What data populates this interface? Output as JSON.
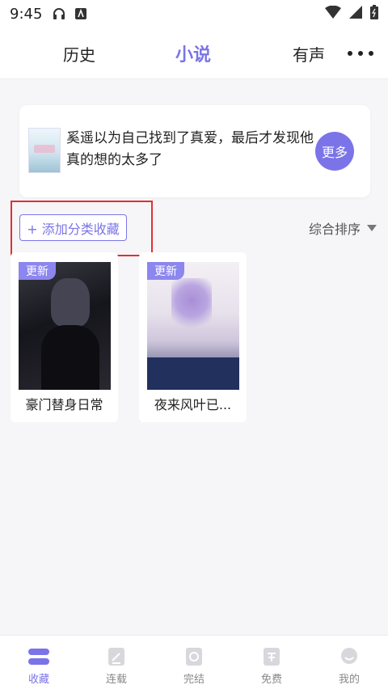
{
  "status_bar": {
    "time": "9:45"
  },
  "top_tabs": [
    {
      "label": "历史"
    },
    {
      "label": "小说"
    },
    {
      "label": "有声"
    }
  ],
  "recommendation": {
    "text": "奚遥以为自己找到了真爱，最后才发现他真的想的太多了",
    "more_label": "更多"
  },
  "toolbar": {
    "add_category_label": "+ 添加分类收藏",
    "sort_label": "综合排序"
  },
  "books": [
    {
      "badge": "更新",
      "title": "豪门替身日常"
    },
    {
      "badge": "更新",
      "title": "夜来风叶已..."
    }
  ],
  "bottom_nav": [
    {
      "label": "收藏"
    },
    {
      "label": "连载"
    },
    {
      "label": "完结"
    },
    {
      "label": "免费"
    },
    {
      "label": "我的"
    }
  ],
  "colors": {
    "accent": "#7b74e8",
    "badge": "#8c86ef",
    "highlight_border": "#e03030"
  }
}
